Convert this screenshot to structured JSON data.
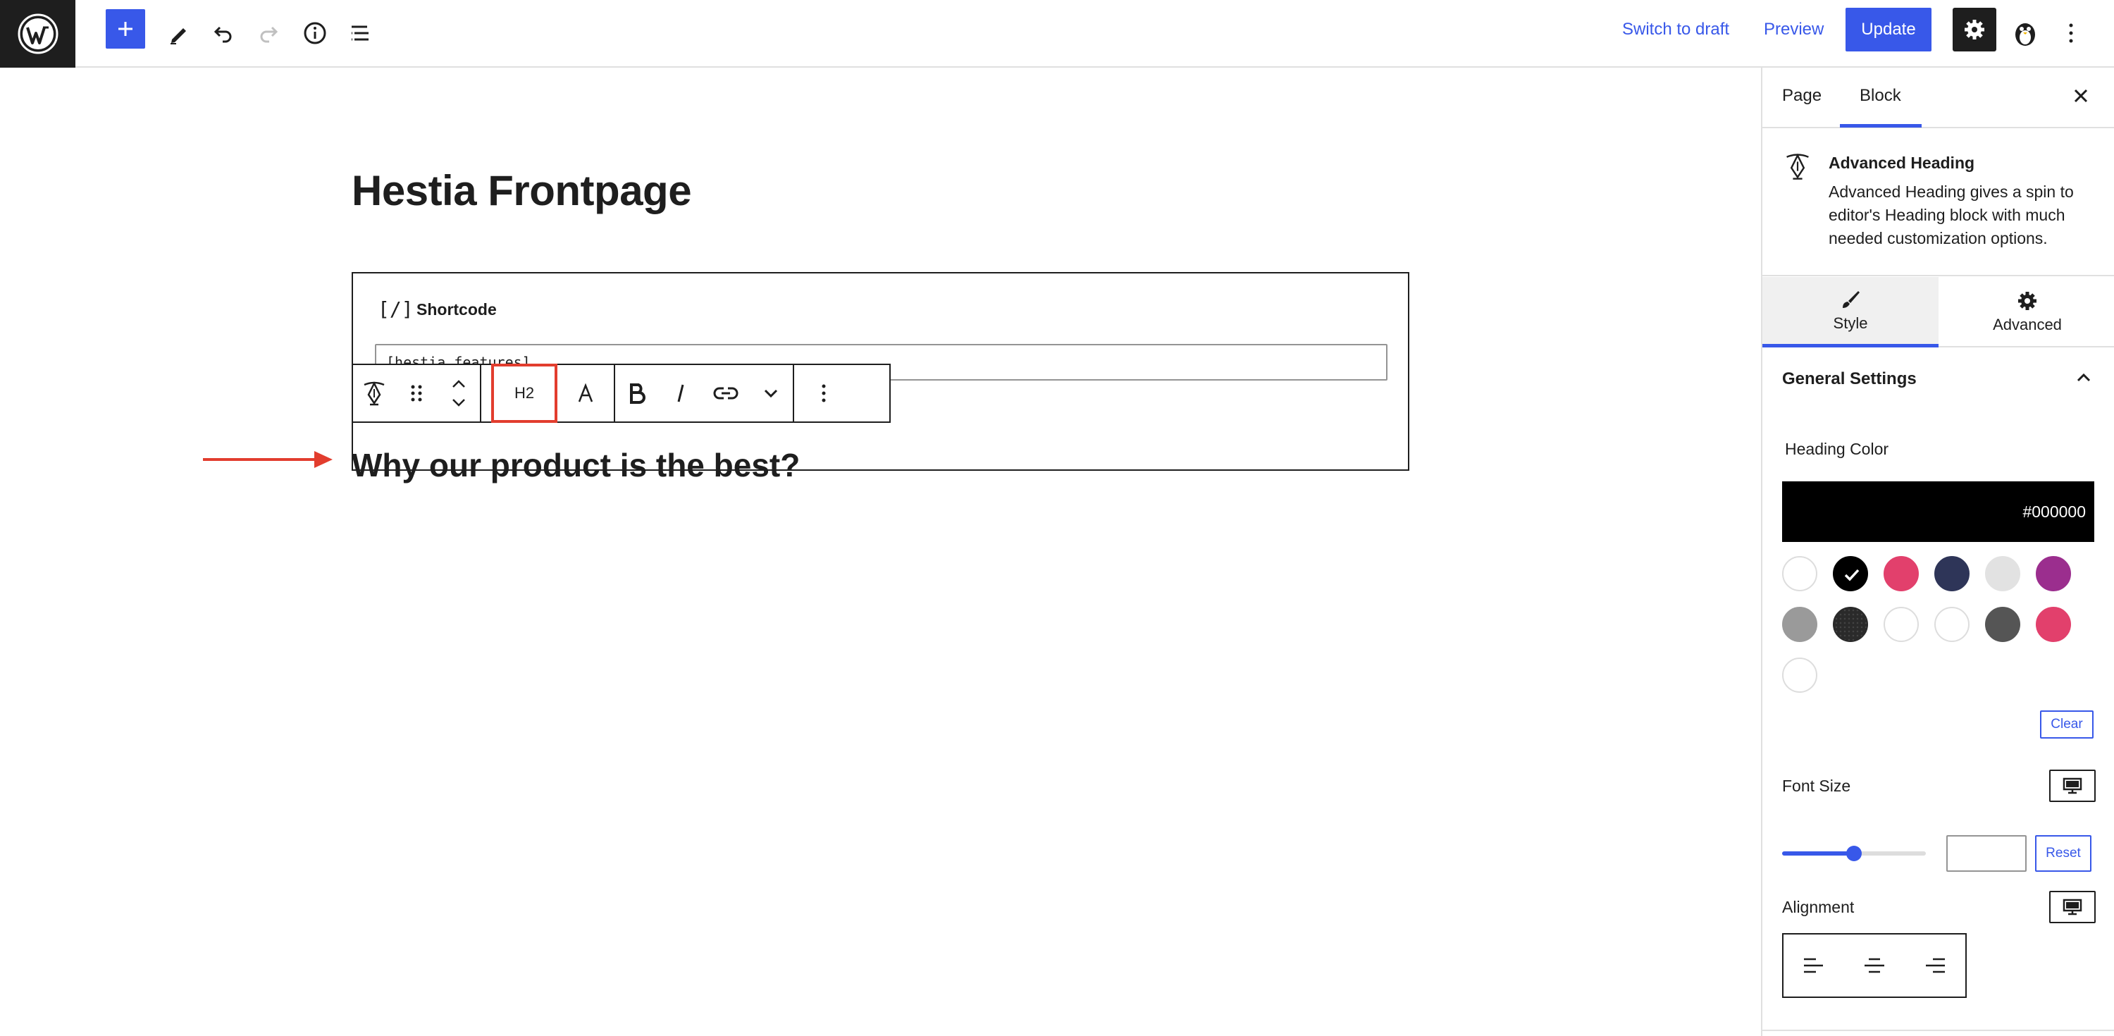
{
  "topbar": {
    "switch_to_draft": "Switch to draft",
    "preview": "Preview",
    "update": "Update"
  },
  "editor": {
    "page_title": "Hestia Frontpage",
    "shortcode_block": {
      "label": "Shortcode",
      "value": "[hestia_features]"
    },
    "block_toolbar": {
      "heading_level": "H2"
    },
    "heading_text": "Why our product is the best?"
  },
  "sidebar": {
    "tabs": [
      "Page",
      "Block"
    ],
    "active_tab": "Block",
    "block_card": {
      "title": "Advanced Heading",
      "description": "Advanced Heading gives a spin to editor's Heading block with much needed customization options."
    },
    "style_tabs": {
      "style": "Style",
      "advanced": "Advanced"
    },
    "general_settings": {
      "title": "General Settings",
      "heading_color_label": "Heading Color",
      "heading_color_value": "#000000",
      "swatches": [
        "#ffffff",
        "#000000",
        "#e2406c",
        "#2e3558",
        "#e2e2e2",
        "#9b2e8e",
        "#9a9a9a",
        "#2a2a2a",
        "#ffffff",
        "#ffffff",
        "#555555",
        "#e2406c",
        "#ffffff"
      ],
      "clear_label": "Clear",
      "font_size_label": "Font Size",
      "font_size_slider": 0.5,
      "reset_label": "Reset",
      "alignment_label": "Alignment"
    }
  },
  "colors": {
    "accent": "#3858e9",
    "highlight": "#e23d2e",
    "dark": "#1e1e1e"
  }
}
